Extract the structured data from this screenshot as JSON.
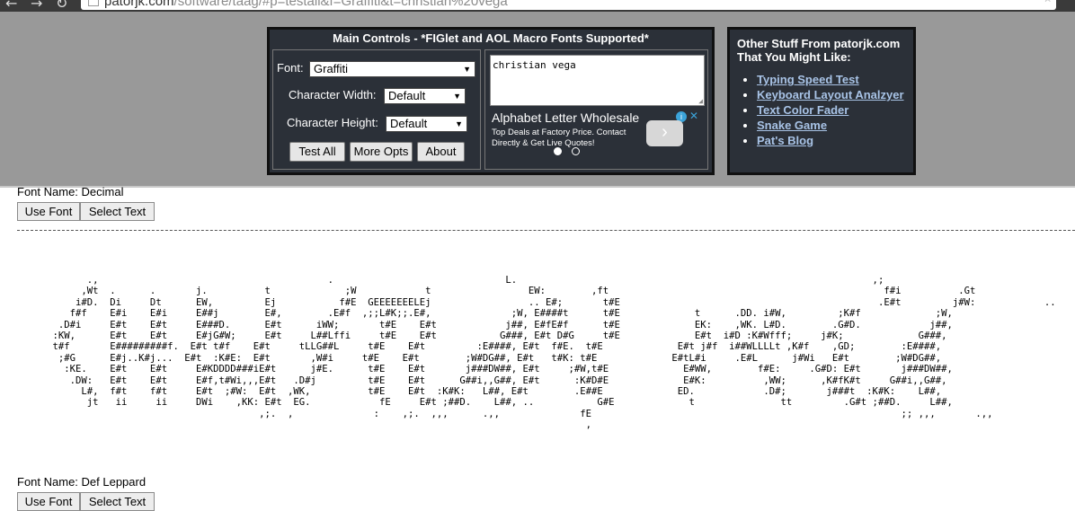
{
  "browser": {
    "url_host": "patorjk.com",
    "url_path": "/software/taag/#p=testall&f=Graffiti&t=christian%20vega"
  },
  "main_controls": {
    "title": "Main Controls - *FIGlet and AOL Macro Fonts Supported*",
    "font_label": "Font:",
    "font_value": "Graffiti",
    "char_width_label": "Character Width:",
    "char_width_value": "Default",
    "char_height_label": "Character Height:",
    "char_height_value": "Default",
    "buttons": [
      "Test All",
      "More Opts",
      "About"
    ],
    "text_input": "christian vega"
  },
  "ad": {
    "title": "Alphabet Letter Wholesale",
    "description": "Top Deals at Factory Price. Contact Directly & Get Live Quotes!"
  },
  "other_stuff": {
    "title": "Other Stuff From patorjk.com That You Might Like:",
    "links": [
      "Typing Speed Test",
      "Keyboard Layout Analzyer",
      "Text Color Fader",
      "Snake Game",
      "Pat's Blog"
    ]
  },
  "fonts": [
    {
      "name": "Font Name: Decimal",
      "use_label": "Use Font",
      "select_label": "Select Text"
    },
    {
      "name": "Font Name: Def Leppard",
      "use_label": "Use Font",
      "select_label": "Select Text",
      "ascii": "          .,                                        .                              L.                                                              ,;\n         ,Wt  .      .       j.          t             ;W            t                 EW:        ,ft                                                f#i          .Gt\n        i#D.  Di     Dt      EW,         Ej           f#E  GEEEEEEELEj                 .. E#;       t#E                                             .E#t         j#W:            ..\n       f#f    E#i    E#i     E##j        E#,        .E#f  ,;;L#K;;.E#,              ;W, E####t      t#E             t      .DD. i#W,         ;K#f             ;W,\n     .D#i     E#t    E#t     E###D.      E#t      iWW;       t#E    E#t            j##, E#fE#f      t#E             EK:    ,WK. L#D.        .G#D.            j##,\n    :KW,      E#t    E#t     E#jG#W;     E#t     L##Lffi     t#E    E#t           G###, E#t D#G     t#E             E#t  i#D :K#Wfff;     j#K;             G###,\n    t#f       E#########f.  E#t t#f    E#t     tLLG##L     t#E    E#t         :E####, E#t  f#E.  t#E             E#t j#f  i##WLLLLt ,K#f    ,GD;        :E####,\n     ;#G      E#j..K#j...  E#t  :K#E:  E#t       ,W#i     t#E    E#t        ;W#DG##, E#t   t#K: t#E             E#tL#i     .E#L      j#Wi   E#t        ;W#DG##,\n      :KE.    E#t    E#t     E#KDDDD###iE#t      j#E.      t#E    E#t       j###DW##, E#t     ;#W,t#E             E#WW,        f#E:     .G#D: E#t       j###DW##,\n       .DW:   E#t    E#t     E#f,t#Wi,,,E#t   .D#j         t#E    E#t      G##i,,G##, E#t      :K#D#E             E#K:          ,WW;      ,K#fK#t     G##i,,G##,\n         L#,  f#t    f#t     E#t  ;#W:  E#t  ,WK,          t#E    E#t  :K#K:   L##, E#t        .E##E             ED.            .D#;       j###t  :K#K:    L##,\n          jt   ii     ii     DWi    ,KK: E#t  EG.            fE     E#t ;##D.    L##, ..           G#E             t               tt         .G#t ;##D.     L##,\n                                        ,;.  ,              :    ,;.  ,,,      .,,              fE                                                      ;; ,,,       .,,\n                                                                                                 ,"
    }
  ]
}
